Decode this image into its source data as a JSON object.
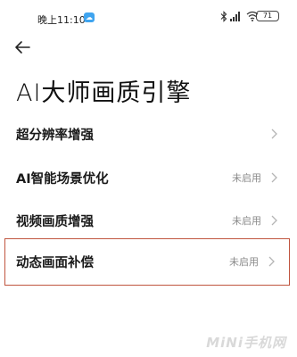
{
  "status_bar": {
    "time": "晚上11:10",
    "cloud_badge": "☁",
    "battery": "71",
    "icons": [
      "bluetooth-icon",
      "signal-hd-icon",
      "wifi-icon",
      "battery-icon"
    ]
  },
  "header": {
    "title": "AI大师画质引擎"
  },
  "settings": [
    {
      "label": "超分辨率增强",
      "value": ""
    },
    {
      "label": "AI智能场景优化",
      "value": "未启用"
    },
    {
      "label": "视频画质增强",
      "value": "未启用"
    },
    {
      "label": "动态画面补偿",
      "value": "未启用",
      "highlighted": true
    }
  ],
  "watermark": "MiNi手机网",
  "colors": {
    "highlight_border": "#c0553f",
    "value_text": "#8a8a8a",
    "chevron": "#b5b5b5"
  }
}
